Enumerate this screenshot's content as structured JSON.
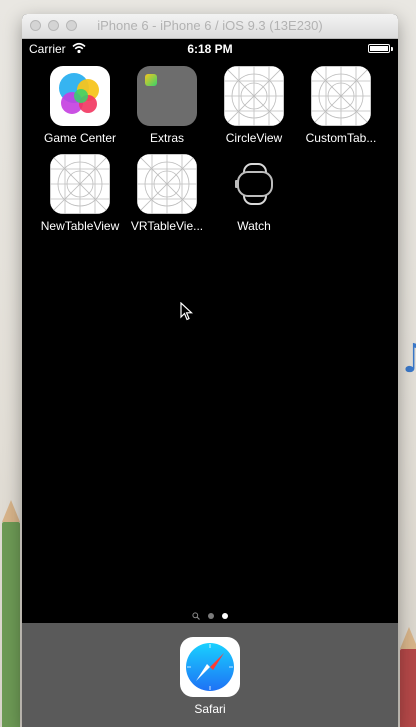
{
  "window": {
    "title": "iPhone 6 - iPhone 6 / iOS 9.3 (13E230)"
  },
  "status_bar": {
    "carrier": "Carrier",
    "time": "6:18 PM",
    "battery_level": 1.0
  },
  "home_apps": [
    {
      "label": "Game Center",
      "icon": "game-center-icon"
    },
    {
      "label": "Extras",
      "icon": "folder-icon"
    },
    {
      "label": "CircleView",
      "icon": "placeholder-app-icon"
    },
    {
      "label": "CustomTab...",
      "icon": "placeholder-app-icon"
    },
    {
      "label": "NewTableView",
      "icon": "placeholder-app-icon"
    },
    {
      "label": "VRTableVie...",
      "icon": "placeholder-app-icon"
    },
    {
      "label": "Watch",
      "icon": "watch-icon"
    }
  ],
  "page_control": {
    "pages": 2,
    "current_page": 2
  },
  "dock": [
    {
      "label": "Safari",
      "icon": "compass-icon"
    }
  ],
  "colors": {
    "dock": "#5a5a5a",
    "screen": "#000000",
    "safari_blue": "#1e90f5"
  }
}
